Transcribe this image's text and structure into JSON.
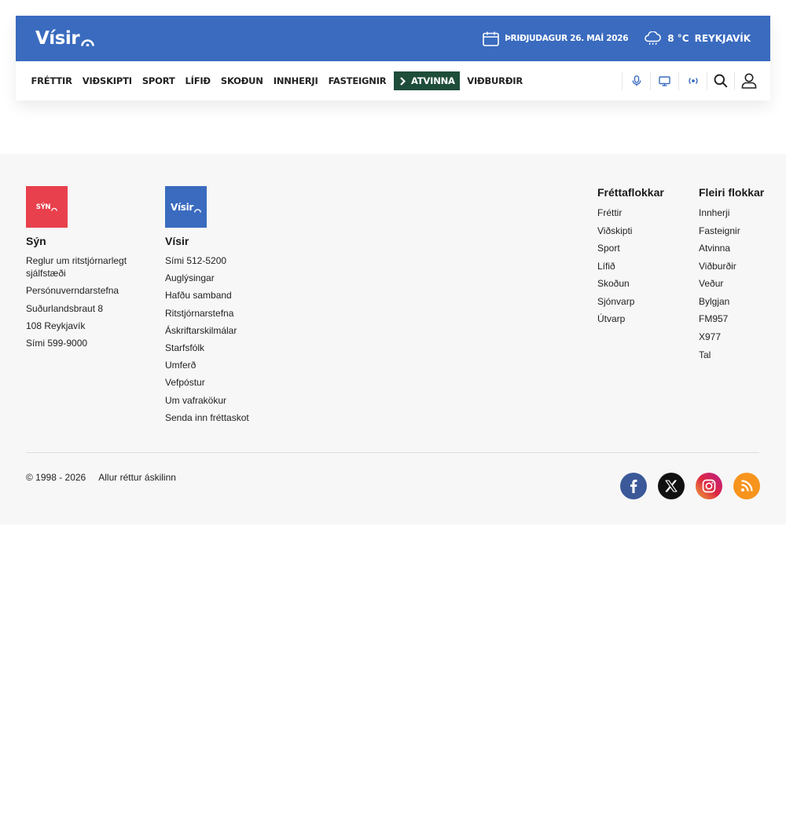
{
  "header": {
    "logo_text": "Vísir",
    "date": "ÞRIÐJUDAGUR 26. MAÍ 2026",
    "temperature": "8 °C",
    "city": "REYKJAVÍK",
    "brand_color": "#3a6bbf"
  },
  "nav": {
    "items": [
      "FRÉTTIR",
      "VIÐSKIPTI",
      "SPORT",
      "LÍFIÐ",
      "SKOÐUN",
      "INNHERJI",
      "FASTEIGNIR"
    ],
    "active": "ATVINNA",
    "after": [
      "VIÐBURÐIR"
    ],
    "active_color": "#1e4d3a",
    "icons": [
      "microphone-icon",
      "tv-icon",
      "radio-icon",
      "search-icon",
      "user-icon"
    ]
  },
  "footer": {
    "syn": {
      "logo_text": "SÝN",
      "title": "Sýn",
      "links": [
        "Reglur um ritstjórnarlegt sjálfstæði",
        "Persónuverndarstefna",
        "Suðurlandsbraut 8",
        "108 Reykjavík",
        "Sími 599-9000"
      ],
      "logo_color": "#e8404d"
    },
    "visir": {
      "logo_text": "Vísir",
      "title": "Vísir",
      "links": [
        "Sími 512-5200",
        "Auglýsingar",
        "Hafðu samband",
        "Ritstjórnarstefna",
        "Áskriftarskilmálar",
        "Starfsfólk",
        "Umferð",
        "Vefpóstur",
        "Um vafrakökur",
        "Senda inn fréttaskot"
      ]
    },
    "frettaflokkar": {
      "title": "Fréttaflokkar",
      "links": [
        "Fréttir",
        "Viðskipti",
        "Sport",
        "Lífið",
        "Skoðun",
        "Sjónvarp",
        "Útvarp"
      ]
    },
    "fleiri": {
      "title": "Fleiri flokkar",
      "links": [
        "Innherji",
        "Fasteignir",
        "Atvinna",
        "Viðburðir",
        "Veður",
        "Bylgjan",
        "FM957",
        "X977",
        "Tal"
      ]
    },
    "copyright": "© 1998 - 2026",
    "rights": "Allur réttur áskilinn",
    "socials": [
      "facebook-icon",
      "x-icon",
      "instagram-icon",
      "rss-icon"
    ]
  }
}
